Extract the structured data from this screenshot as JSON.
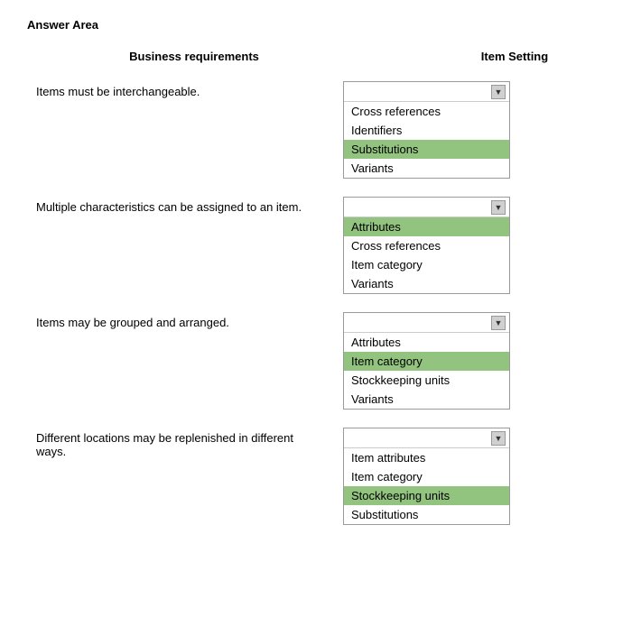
{
  "title": "Answer Area",
  "headers": {
    "business": "Business requirements",
    "itemSetting": "Item Setting"
  },
  "rows": [
    {
      "id": "row1",
      "requirement": "Items must be interchangeable.",
      "dropdown": {
        "items": [
          {
            "label": "Cross references",
            "selected": false
          },
          {
            "label": "Identifiers",
            "selected": false
          },
          {
            "label": "Substitutions",
            "selected": true
          },
          {
            "label": "Variants",
            "selected": false
          }
        ]
      }
    },
    {
      "id": "row2",
      "requirement": "Multiple characteristics can be assigned to an item.",
      "dropdown": {
        "items": [
          {
            "label": "Attributes",
            "selected": true
          },
          {
            "label": "Cross references",
            "selected": false
          },
          {
            "label": "Item category",
            "selected": false
          },
          {
            "label": "Variants",
            "selected": false
          }
        ]
      }
    },
    {
      "id": "row3",
      "requirement": "Items may be grouped and arranged.",
      "dropdown": {
        "items": [
          {
            "label": "Attributes",
            "selected": false
          },
          {
            "label": "Item category",
            "selected": true
          },
          {
            "label": "Stockkeeping units",
            "selected": false
          },
          {
            "label": "Variants",
            "selected": false
          }
        ]
      }
    },
    {
      "id": "row4",
      "requirement": "Different locations may be replenished in different ways.",
      "dropdown": {
        "items": [
          {
            "label": "Item attributes",
            "selected": false
          },
          {
            "label": "Item category",
            "selected": false
          },
          {
            "label": "Stockkeeping units",
            "selected": true
          },
          {
            "label": "Substitutions",
            "selected": false
          }
        ]
      }
    }
  ]
}
